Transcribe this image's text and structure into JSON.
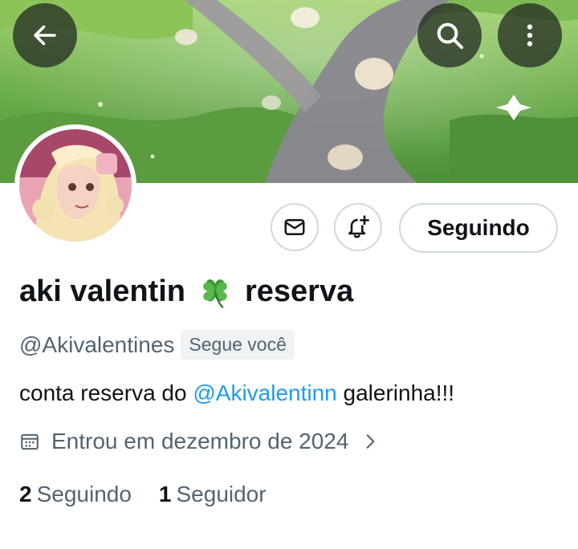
{
  "profile": {
    "display_name_part1": "aki valentin",
    "display_name_part2": "reserva",
    "name_emoji": "four-leaf-clover",
    "handle": "@Akivalentines",
    "follows_you": "Segue você",
    "bio": {
      "before": "conta reserva do ",
      "mention": "@Akivalentinn",
      "after": " galerinha!!!"
    },
    "joined": "Entrou em dezembro de 2024",
    "following_count": "2",
    "following_label": "Seguindo",
    "followers_count": "1",
    "followers_label": "Seguidor"
  },
  "actions": {
    "follow_state_label": "Seguindo",
    "message_icon": "envelope-icon",
    "notify_icon": "bell-plus-icon"
  },
  "header": {
    "back_icon": "arrow-left-icon",
    "search_icon": "search-icon",
    "more_icon": "more-vertical-icon"
  },
  "colors": {
    "link": "#1d9bf0",
    "text_primary": "#0f1419",
    "text_secondary": "#536471",
    "border": "#cfd9de"
  }
}
